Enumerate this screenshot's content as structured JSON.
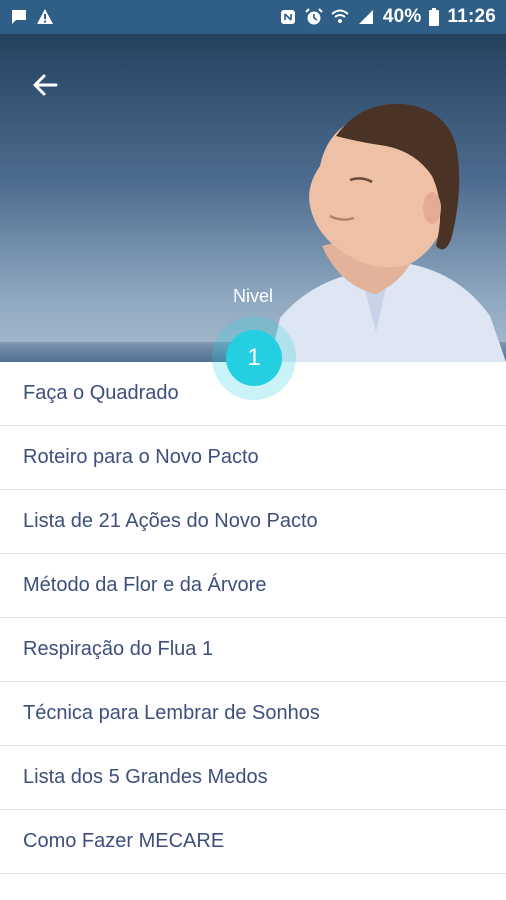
{
  "status_bar": {
    "battery_percent": "40%",
    "time": "11:26",
    "left_icons": [
      "chat-icon",
      "warning-icon"
    ],
    "right_icons": [
      "nfc-icon",
      "alarm-icon",
      "wifi-icon",
      "signal-icon",
      "battery-icon"
    ]
  },
  "header": {
    "back_icon": "arrow-left-icon",
    "level_label": "Nivel",
    "level_number": "1"
  },
  "lessons": [
    {
      "label": "Faça o Quadrado"
    },
    {
      "label": "Roteiro para o Novo Pacto"
    },
    {
      "label": "Lista de 21 Ações do Novo Pacto"
    },
    {
      "label": "Método da Flor e da Árvore"
    },
    {
      "label": "Respiração do Flua 1"
    },
    {
      "label": "Técnica para Lembrar de Sonhos"
    },
    {
      "label": "Lista dos 5 Grandes Medos"
    },
    {
      "label": "Como Fazer MECARE"
    }
  ],
  "colors": {
    "status_bar": "#2f5f86",
    "accent": "#23cfe0",
    "list_text": "#3d4f7c"
  }
}
